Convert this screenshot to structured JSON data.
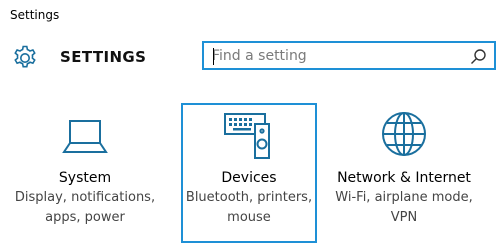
{
  "window": {
    "title": "Settings"
  },
  "header": {
    "heading": "SETTINGS",
    "gear_icon": "gear-icon",
    "search": {
      "placeholder": "Find a setting",
      "value": "",
      "icon": "search-icon"
    }
  },
  "categories": [
    {
      "title": "System",
      "description_lines": [
        "Display, notifications,",
        "apps, power"
      ],
      "icon": "laptop-icon",
      "selected": false
    },
    {
      "title": "Devices",
      "description_lines": [
        "Bluetooth, printers,",
        "mouse"
      ],
      "icon": "keyboard-speaker-icon",
      "selected": true
    },
    {
      "title": "Network & Internet",
      "description_lines": [
        "Wi-Fi, airplane mode,",
        "VPN"
      ],
      "icon": "globe-icon",
      "selected": false
    }
  ],
  "colors": {
    "accent": "#1e90d6",
    "icon": "#1a6f9e",
    "text": "#000000",
    "muted_text": "#444444"
  }
}
